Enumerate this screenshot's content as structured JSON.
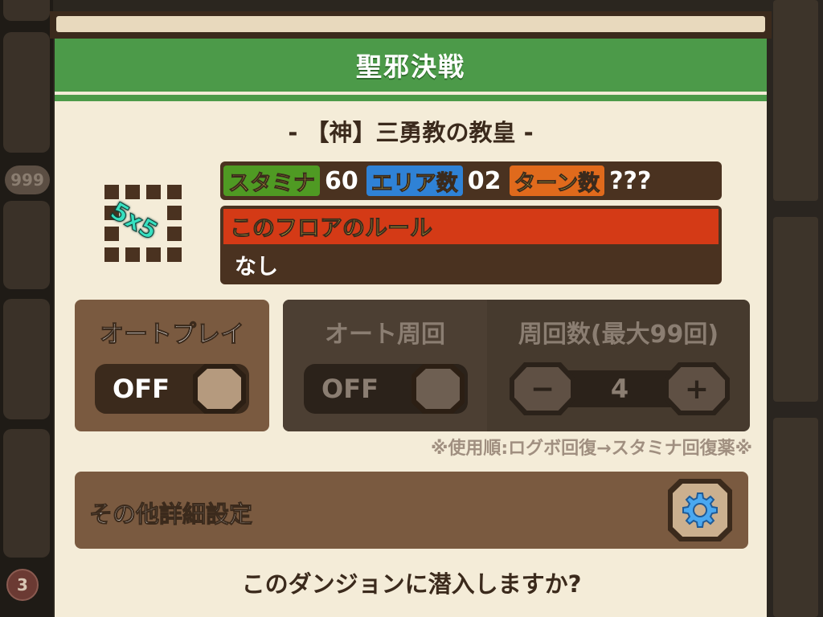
{
  "background": {
    "badge_text": "999",
    "circle_text": "3"
  },
  "dialog": {
    "title": "聖邪決戦",
    "subtitle": "- 【神】三勇教の教皇 -",
    "map_size": "5x5",
    "stats": {
      "stamina_label": "スタミナ",
      "stamina_value": "60",
      "area_label": "エリア数",
      "area_value": "02",
      "turn_label": "ターン数",
      "turn_value": "???"
    },
    "rule": {
      "header": "このフロアのルール",
      "value": "なし"
    },
    "auto_play": {
      "title": "オートプレイ",
      "state": "OFF"
    },
    "auto_loop": {
      "title": "オート周回",
      "state": "OFF",
      "count_title": "周回数(最大99回)",
      "count_value": "4",
      "minus": "−",
      "plus": "+"
    },
    "note": "※使用順:ログボ回復→スタミナ回復薬※",
    "other_settings": "その他詳細設定",
    "question": "このダンジョンに潜入しますか?"
  },
  "colors": {
    "title_green": "#4c9a49",
    "panel_brown": "#7a5a40",
    "rule_red": "#d43a16",
    "stamina_green": "#4f9a23",
    "area_blue": "#2f82d6",
    "turn_orange": "#e06a1c"
  },
  "icons": [
    "grid-5x5-icon",
    "gear-icon",
    "minus-icon",
    "plus-icon"
  ]
}
